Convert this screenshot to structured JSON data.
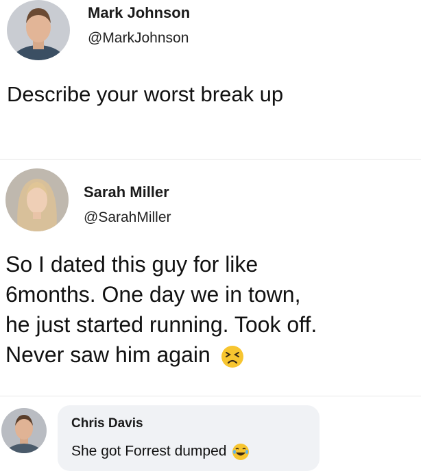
{
  "post": {
    "author": {
      "name": "Mark Johnson",
      "handle": "@MarkJohnson"
    },
    "text": "Describe your worst break up"
  },
  "reply": {
    "author": {
      "name": "Sarah Miller",
      "handle": "@SarahMiller"
    },
    "text_lines": [
      "So I dated this guy for like",
      "6months. One day we in town,",
      "he just started running. Took off.",
      "Never saw him again"
    ],
    "emoji": "persevering-face"
  },
  "comment": {
    "author": {
      "name": "Chris Davis"
    },
    "text": "She got Forrest dumped",
    "emoji": "face-with-tears-of-joy"
  },
  "colors": {
    "background": "#ffffff",
    "comment_bubble": "#f0f2f5",
    "emoji_yellow": "#f7c530"
  }
}
